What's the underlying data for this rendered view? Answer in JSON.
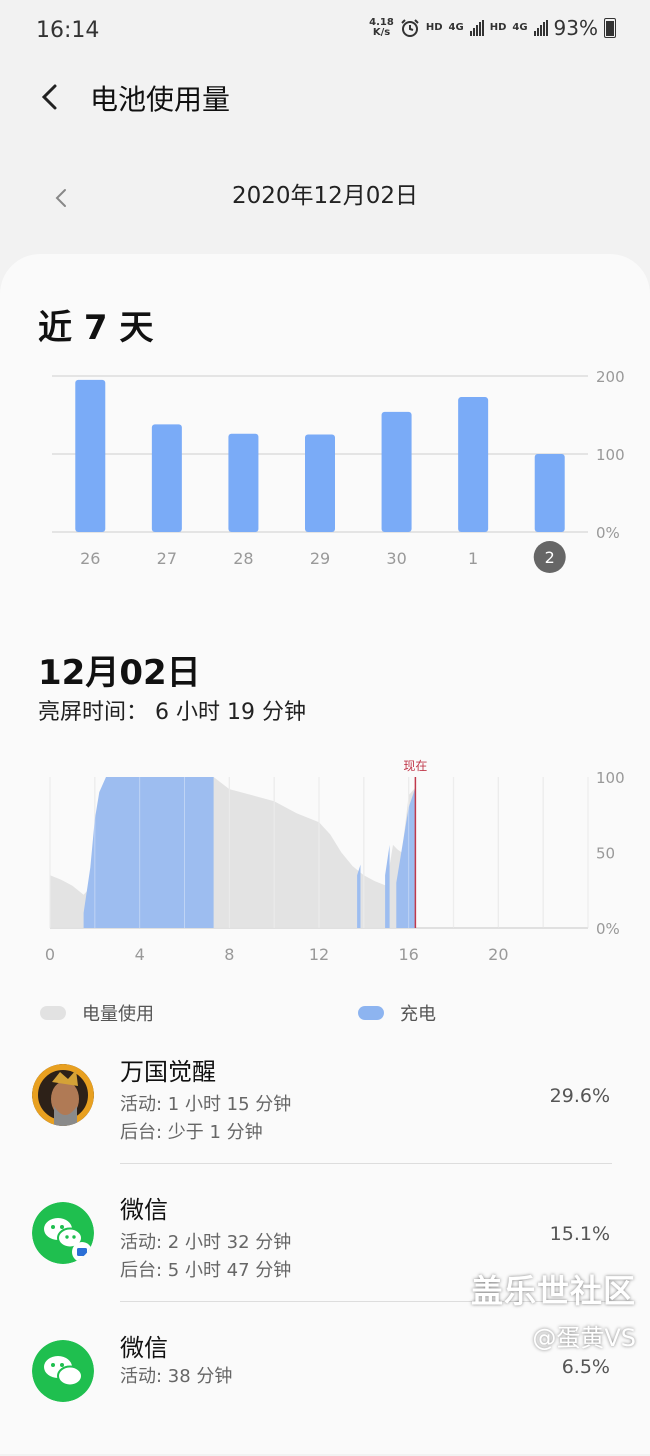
{
  "status_bar": {
    "time": "16:14",
    "net_speed_value": "4.18",
    "net_speed_unit": "K/s",
    "hd1": "HD",
    "net1": "4G",
    "hd2": "HD",
    "net2": "4G",
    "battery_percent": "93%"
  },
  "header": {
    "title": "电池使用量",
    "back_icon": "back-arrow-icon"
  },
  "date_nav": {
    "date": "2020年12月02日",
    "prev_icon": "chevron-left-icon"
  },
  "weekly": {
    "title": "近 7 天"
  },
  "daily": {
    "title": "12月02日",
    "screen_time": "亮屏时间： 6 小时 19 分钟"
  },
  "chart_data": [
    {
      "type": "bar",
      "categories": [
        "26",
        "27",
        "28",
        "29",
        "30",
        "1",
        "2"
      ],
      "values": [
        195,
        138,
        126,
        125,
        154,
        173,
        100
      ],
      "y_tick_labels": [
        "200",
        "100",
        "0%"
      ],
      "ylim": [
        0,
        200
      ],
      "selected_category": "2",
      "bar_color": "#7aabf7"
    },
    {
      "type": "area",
      "x_tick_labels": [
        "0",
        "4",
        "8",
        "12",
        "16",
        "20"
      ],
      "y_tick_labels": [
        "100",
        "50",
        "0%"
      ],
      "xlim": [
        0,
        24
      ],
      "ylim": [
        0,
        100
      ],
      "now_label": "现在",
      "now_hour": 16.3,
      "series": [
        {
          "name": "电量使用",
          "color": "#e2e2e2",
          "points": [
            [
              0,
              35
            ],
            [
              0.5,
              32
            ],
            [
              1.0,
              28
            ],
            [
              1.5,
              22
            ],
            [
              2.0,
              30
            ],
            [
              2.5,
              100
            ],
            [
              7.3,
              100
            ],
            [
              8,
              92
            ],
            [
              9,
              88
            ],
            [
              10,
              84
            ],
            [
              11,
              76
            ],
            [
              12,
              70
            ],
            [
              12.5,
              62
            ],
            [
              13,
              50
            ],
            [
              13.5,
              41
            ],
            [
              14,
              35
            ],
            [
              14.5,
              31
            ],
            [
              15,
              28
            ],
            [
              15.3,
              55
            ],
            [
              15.5,
              52
            ],
            [
              15.7,
              50
            ],
            [
              16,
              88
            ],
            [
              16.3,
              93
            ]
          ]
        },
        {
          "name": "充电",
          "color": "#9dbdf0",
          "segments": [
            [
              [
                1.5,
                0
              ],
              [
                1.5,
                10
              ],
              [
                1.8,
                40
              ],
              [
                2.0,
                72
              ],
              [
                2.2,
                90
              ],
              [
                2.5,
                100
              ],
              [
                7.3,
                100
              ],
              [
                7.3,
                0
              ]
            ],
            [
              [
                13.7,
                0
              ],
              [
                13.7,
                35
              ],
              [
                13.85,
                42
              ],
              [
                13.85,
                0
              ]
            ],
            [
              [
                14.95,
                0
              ],
              [
                14.95,
                35
              ],
              [
                15.15,
                55
              ],
              [
                15.15,
                0
              ]
            ],
            [
              [
                15.45,
                0
              ],
              [
                15.45,
                30
              ],
              [
                16.0,
                80
              ],
              [
                16.3,
                93
              ],
              [
                16.3,
                0
              ]
            ]
          ]
        }
      ]
    }
  ],
  "legend": {
    "usage": "电量使用",
    "charging": "充电"
  },
  "apps": [
    {
      "name": "万国觉醒",
      "active": "活动: 1 小时 15 分钟",
      "background": "后台: 少于 1 分钟",
      "percent": "29.6%",
      "icon": "rise-of-kingdoms-icon"
    },
    {
      "name": "微信",
      "active": "活动: 2 小时 32 分钟",
      "background": "后台: 5 小时 47 分钟",
      "percent": "15.1%",
      "icon": "wechat-icon"
    },
    {
      "name": "微信",
      "active": "活动: 38 分钟",
      "percent": "6.5%",
      "icon": "wechat-icon"
    }
  ],
  "watermark": {
    "line1": "盖乐世社区",
    "line2": "@蛋黄VS"
  }
}
